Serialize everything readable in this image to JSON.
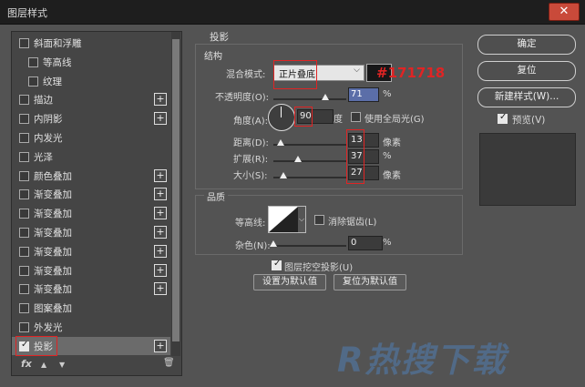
{
  "window": {
    "title": "图层样式",
    "close_label": "✕"
  },
  "sidebar": {
    "items": [
      {
        "label": "斜面和浮雕",
        "checked": false,
        "plus": false,
        "indent": false
      },
      {
        "label": "等高线",
        "checked": false,
        "plus": false,
        "indent": true
      },
      {
        "label": "纹理",
        "checked": false,
        "plus": false,
        "indent": true
      },
      {
        "label": "描边",
        "checked": false,
        "plus": true,
        "indent": false
      },
      {
        "label": "内阴影",
        "checked": false,
        "plus": true,
        "indent": false
      },
      {
        "label": "内发光",
        "checked": false,
        "plus": false,
        "indent": false
      },
      {
        "label": "光泽",
        "checked": false,
        "plus": false,
        "indent": false
      },
      {
        "label": "颜色叠加",
        "checked": false,
        "plus": true,
        "indent": false
      },
      {
        "label": "渐变叠加",
        "checked": false,
        "plus": true,
        "indent": false
      },
      {
        "label": "渐变叠加",
        "checked": false,
        "plus": true,
        "indent": false
      },
      {
        "label": "渐变叠加",
        "checked": false,
        "plus": true,
        "indent": false
      },
      {
        "label": "渐变叠加",
        "checked": false,
        "plus": true,
        "indent": false
      },
      {
        "label": "渐变叠加",
        "checked": false,
        "plus": true,
        "indent": false
      },
      {
        "label": "渐变叠加",
        "checked": false,
        "plus": true,
        "indent": false
      },
      {
        "label": "图案叠加",
        "checked": false,
        "plus": false,
        "indent": false
      },
      {
        "label": "外发光",
        "checked": false,
        "plus": false,
        "indent": false
      },
      {
        "label": "投影",
        "checked": true,
        "plus": true,
        "indent": false,
        "selected": true
      }
    ],
    "fx_label": "fx",
    "up_icon": "▲",
    "down_icon": "▼",
    "trash_icon": "🗑"
  },
  "drop_shadow": {
    "section_title": "投影",
    "structure_title": "结构",
    "blend_mode_label": "混合模式:",
    "blend_mode_value": "正片叠底",
    "color_hex_label": "#171718",
    "color_value": "#171718",
    "opacity_label": "不透明度(O):",
    "opacity_value": "71",
    "opacity_unit": "%",
    "opacity_fraction": 0.71,
    "angle_label": "角度(A):",
    "angle_value": "90",
    "angle_unit": "度",
    "global_light_label": "使用全局光(G)",
    "global_light_checked": false,
    "distance_label": "距离(D):",
    "distance_value": "13",
    "distance_unit": "像素",
    "spread_label": "扩展(R):",
    "spread_value": "37",
    "spread_unit": "%",
    "size_label": "大小(S):",
    "size_value": "27",
    "size_unit": "像素",
    "quality_title": "品质",
    "contour_label": "等高线:",
    "antialias_label": "消除锯齿(L)",
    "antialias_checked": false,
    "noise_label": "杂色(N):",
    "noise_value": "0",
    "noise_unit": "%",
    "knockout_label": "图层挖空投影(U)",
    "knockout_checked": true,
    "set_default_label": "设置为默认值",
    "reset_default_label": "复位为默认值"
  },
  "actions": {
    "ok_label": "确定",
    "reset_label": "复位",
    "new_style_label": "新建样式(W)...",
    "preview_label": "预览(V)",
    "preview_checked": true
  },
  "watermark": {
    "text": "R热搜下载"
  }
}
